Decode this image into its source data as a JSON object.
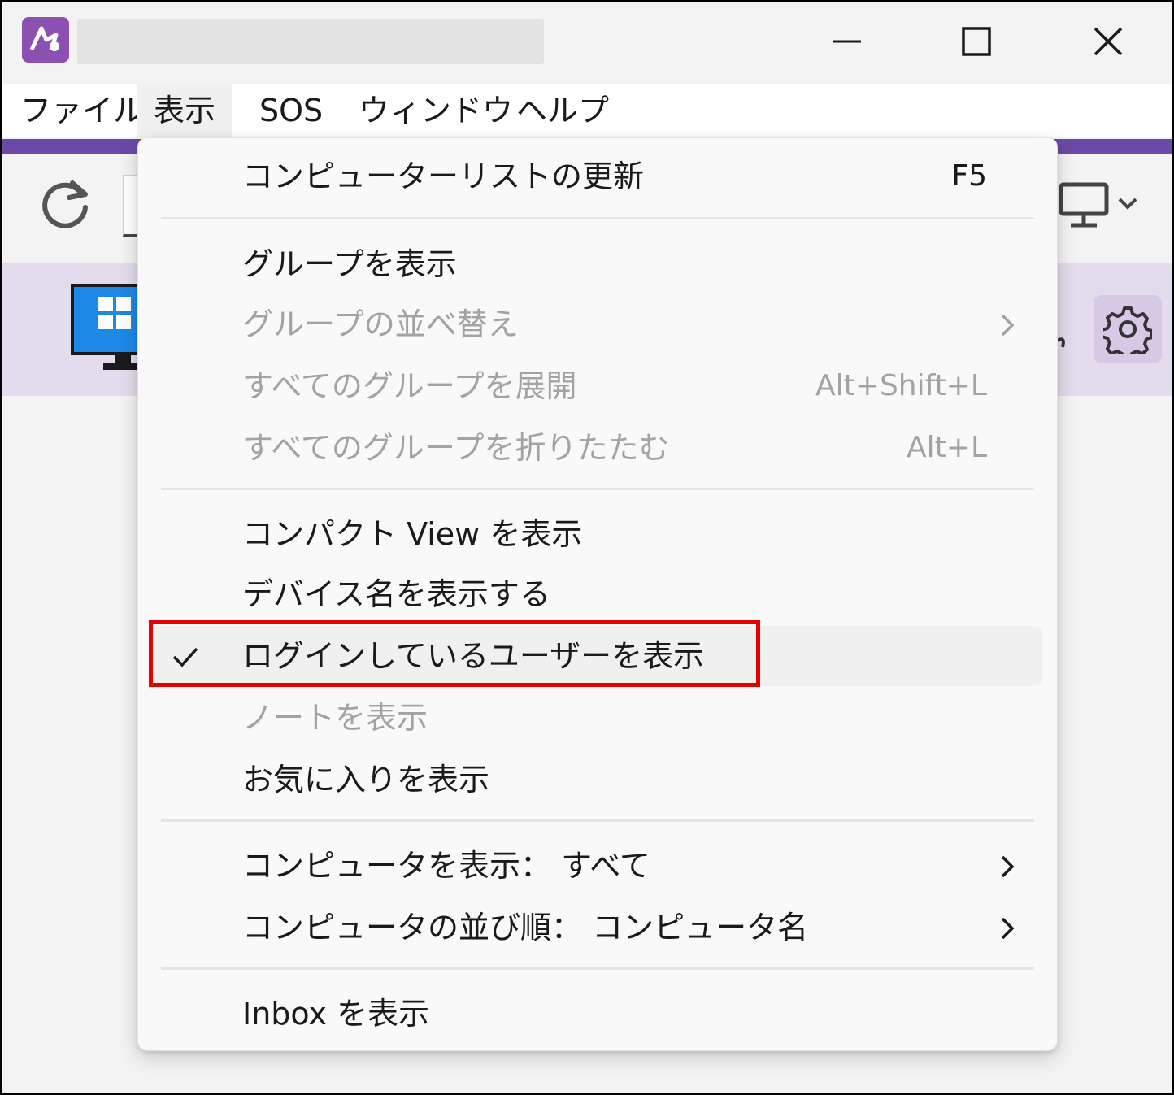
{
  "colors": {
    "accent": "#6a4aa6",
    "highlight_box": "#e60000",
    "disabled_text": "#a3a3a3",
    "device_strip": "#e3dcec"
  },
  "menubar": {
    "items": [
      {
        "label": "ファイル"
      },
      {
        "label": "表示"
      },
      {
        "label": "SOS"
      },
      {
        "label": "ウィンドウ"
      },
      {
        "label": "ヘルプ"
      }
    ]
  },
  "view_menu": {
    "items": [
      {
        "label": "コンピューターリストの更新",
        "shortcut": "F5",
        "enabled": true
      },
      {
        "label": "グループを表示",
        "enabled": true
      },
      {
        "label": "グループの並べ替え",
        "enabled": false,
        "submenu": true
      },
      {
        "label": "すべてのグループを展開",
        "shortcut": "Alt+Shift+L",
        "enabled": false
      },
      {
        "label": "すべてのグループを折りたたむ",
        "shortcut": "Alt+L",
        "enabled": false
      },
      {
        "label": "コンパクト View を表示",
        "enabled": true
      },
      {
        "label": "デバイス名を表示する",
        "enabled": true
      },
      {
        "label": "ログインしているユーザーを表示",
        "enabled": true,
        "checked": true
      },
      {
        "label": "ノートを表示",
        "enabled": false
      },
      {
        "label": "お気に入りを表示",
        "enabled": true
      },
      {
        "label": "コンピュータを表示： すべて",
        "enabled": true,
        "submenu": true
      },
      {
        "label": "コンピュータの並び順： コンピュータ名",
        "enabled": true,
        "submenu": true
      },
      {
        "label": "Inbox を表示",
        "enabled": true
      }
    ]
  },
  "icons": {
    "app_logo": "app-logo-icon",
    "minimize": "minimize-icon",
    "maximize": "maximize-icon",
    "close": "close-icon",
    "refresh": "refresh-icon",
    "monitor": "monitor-icon",
    "chevron": "chevron-down-icon",
    "windows": "windows-device-icon",
    "gear": "gear-icon",
    "check": "check-icon",
    "submenu": "chevron-right-icon"
  }
}
